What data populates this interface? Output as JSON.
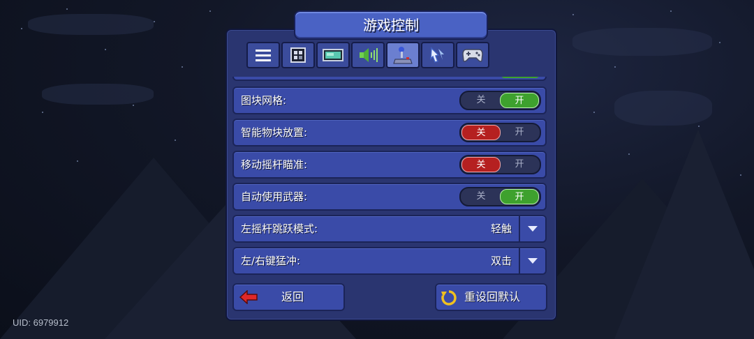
{
  "title": "游戏控制",
  "uid_text": "UID: 6979912",
  "tabs": [
    {
      "icon": "menu-lines-icon",
      "active": false
    },
    {
      "icon": "inventory-grid-icon",
      "active": false
    },
    {
      "icon": "display-screen-icon",
      "active": false
    },
    {
      "icon": "speaker-volume-icon",
      "active": false
    },
    {
      "icon": "joystick-icon",
      "active": true
    },
    {
      "icon": "cursor-hand-icon",
      "active": false
    },
    {
      "icon": "gamepad-icon",
      "active": false
    }
  ],
  "settings": [
    {
      "label": "图块网格:",
      "type": "toggle",
      "off_label": "关",
      "on_label": "开",
      "value": "on"
    },
    {
      "label": "智能物块放置:",
      "type": "toggle",
      "off_label": "关",
      "on_label": "开",
      "value": "off"
    },
    {
      "label": "移动摇杆瞄准:",
      "type": "toggle",
      "off_label": "关",
      "on_label": "开",
      "value": "off"
    },
    {
      "label": "自动使用武器:",
      "type": "toggle",
      "off_label": "关",
      "on_label": "开",
      "value": "on"
    },
    {
      "label": "左摇杆跳跃模式:",
      "type": "dropdown",
      "value": "轻触"
    },
    {
      "label": "左/右键猛冲:",
      "type": "dropdown",
      "value": "双击"
    }
  ],
  "buttons": {
    "back_label": "返回",
    "reset_label": "重设回默认"
  },
  "colors": {
    "on_green": "#3ea12e",
    "off_red": "#b52020",
    "panel": "#2a3570",
    "row": "#3a4ba8"
  }
}
